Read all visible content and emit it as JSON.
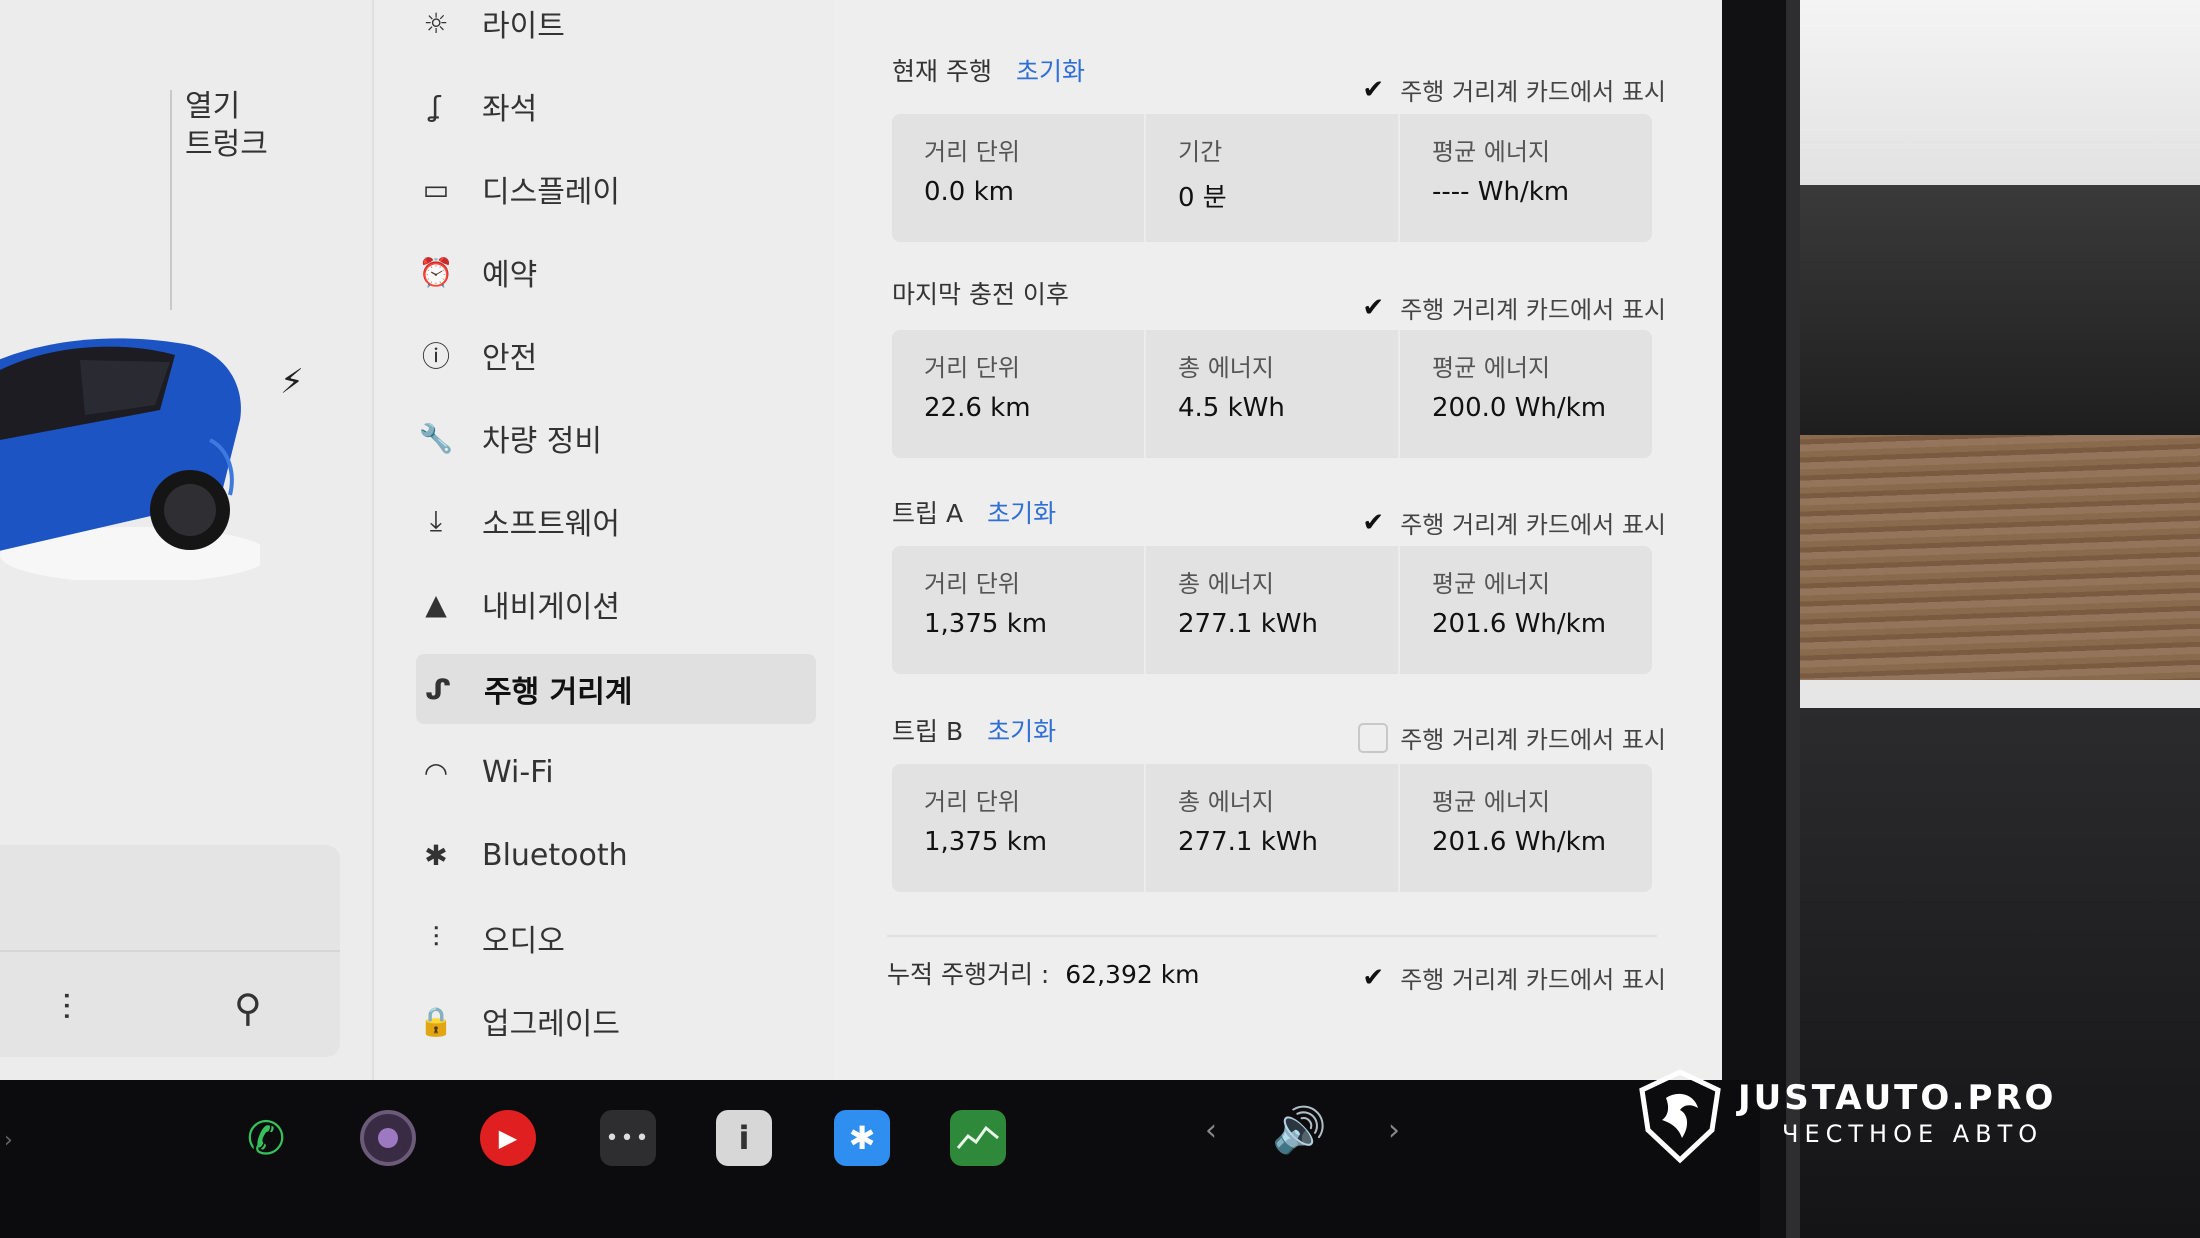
{
  "car_panel": {
    "frunk_label_line1": "열기",
    "frunk_label_line2": "트렁크"
  },
  "menu": {
    "items": [
      {
        "label": "라이트",
        "icon": "light-icon",
        "glyph": "☼"
      },
      {
        "label": "좌석",
        "icon": "seat-icon",
        "glyph": "ʆ"
      },
      {
        "label": "디스플레이",
        "icon": "display-icon",
        "glyph": "▭"
      },
      {
        "label": "예약",
        "icon": "schedule-icon",
        "glyph": "⏰"
      },
      {
        "label": "안전",
        "icon": "safety-icon",
        "glyph": "ⓘ"
      },
      {
        "label": "차량 정비",
        "icon": "wrench-icon",
        "glyph": "🔧"
      },
      {
        "label": "소프트웨어",
        "icon": "download-icon",
        "glyph": "⤓"
      },
      {
        "label": "내비게이션",
        "icon": "navigation-icon",
        "glyph": "▲"
      },
      {
        "label": "주행 거리계",
        "icon": "trips-icon",
        "glyph": "ᔑ"
      },
      {
        "label": "Wi-Fi",
        "icon": "wifi-icon",
        "glyph": "◠"
      },
      {
        "label": "Bluetooth",
        "icon": "bluetooth-icon",
        "glyph": "✱"
      },
      {
        "label": "오디오",
        "icon": "audio-icon",
        "glyph": "⫶"
      },
      {
        "label": "업그레이드",
        "icon": "upgrade-icon",
        "glyph": "🔒"
      }
    ],
    "active": "주행 거리계"
  },
  "trips": {
    "show_label": "주행 거리계 카드에서 표시",
    "current": {
      "title": "현재 주행",
      "reset": "초기화",
      "show": true,
      "cells": [
        {
          "label": "거리 단위",
          "value": "0.0  km"
        },
        {
          "label": "기간",
          "value": "0  분"
        },
        {
          "label": "평균 에너지",
          "value": "----  Wh/km"
        }
      ]
    },
    "since_charge": {
      "title": "마지막 충전 이후",
      "show": true,
      "cells": [
        {
          "label": "거리 단위",
          "value": "22.6  km"
        },
        {
          "label": "총 에너지",
          "value": "4.5  kWh"
        },
        {
          "label": "평균 에너지",
          "value": "200.0  Wh/km"
        }
      ]
    },
    "trip_a": {
      "title": "트립 A",
      "reset": "초기화",
      "show": true,
      "cells": [
        {
          "label": "거리 단위",
          "value": "1,375  km"
        },
        {
          "label": "총 에너지",
          "value": "277.1 kWh"
        },
        {
          "label": "평균 에너지",
          "value": "201.6  Wh/km"
        }
      ]
    },
    "trip_b": {
      "title": "트립 B",
      "reset": "초기화",
      "show": false,
      "cells": [
        {
          "label": "거리 단위",
          "value": "1,375  km"
        },
        {
          "label": "총 에너지",
          "value": "277.1 kWh"
        },
        {
          "label": "평균 에너지",
          "value": "201.6  Wh/km"
        }
      ]
    },
    "odometer": {
      "label": "누적 주행거리 :",
      "value": "62,392 km",
      "show": true
    }
  },
  "taskbar": {
    "manual_glyph": "i",
    "more_glyph": "•••"
  },
  "watermark": {
    "title": "JUSTAUTO.PRO",
    "subtitle": "ЧЕСТНОЕ АВТО"
  }
}
